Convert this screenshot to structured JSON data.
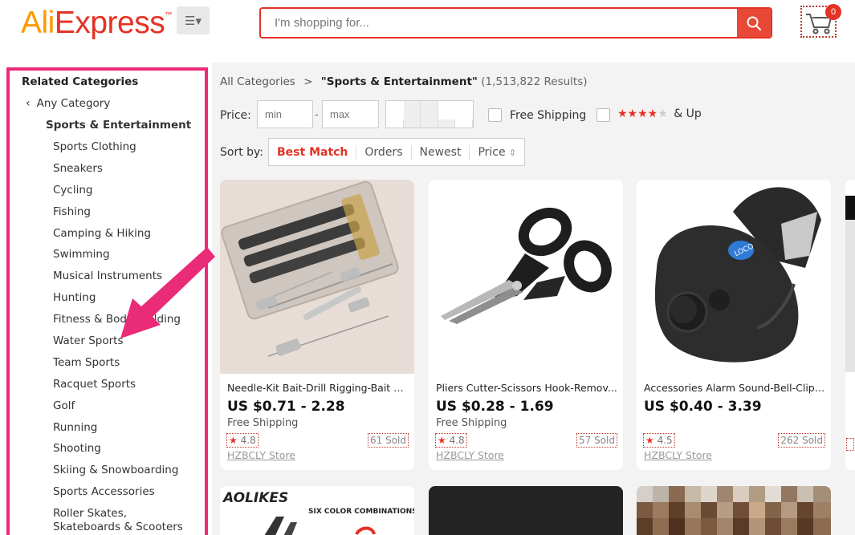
{
  "header": {
    "logo_part1": "Ali",
    "logo_part2": "Express",
    "logo_tm": "™",
    "search_placeholder": "I'm shopping for...",
    "cart_count": "0",
    "icons": [
      "menu-icon",
      "search-icon",
      "cart-icon"
    ]
  },
  "sidebar": {
    "title": "Related Categories",
    "any_category": "Any Category",
    "current": "Sports & Entertainment",
    "items": [
      "Sports Clothing",
      "Sneakers",
      "Cycling",
      "Fishing",
      "Camping & Hiking",
      "Swimming",
      "Musical Instruments",
      "Hunting",
      "Fitness & Body Building",
      "Water Sports",
      "Team Sports",
      "Racquet Sports",
      "Golf",
      "Running",
      "Shooting",
      "Skiing & Snowboarding",
      "Sports Accessories",
      "Roller Skates, Skateboards & Scooters"
    ]
  },
  "breadcrumb": {
    "root": "All Categories",
    "separator": ">",
    "current": "\"Sports & Entertainment\"",
    "count": "(1,513,822 Results)"
  },
  "filters": {
    "price_label": "Price:",
    "min_placeholder": "min",
    "max_placeholder": "max",
    "dash": "-",
    "free_shipping": "Free Shipping",
    "rating_stars_on": "★★★★",
    "rating_stars_off": "★",
    "rating_suffix": "& Up"
  },
  "sort": {
    "label": "Sort by:",
    "options": [
      "Best Match",
      "Orders",
      "Newest",
      "Price"
    ],
    "active": "Best Match",
    "price_icon": "⇕"
  },
  "products": [
    {
      "title": "Needle-Kit Bait-Drill Rigging-Bait St...",
      "price": "US $0.71 - 2.28",
      "shipping": "Free Shipping",
      "rating": "4.8",
      "sold": "61 Sold",
      "store": "HZBCLY Store"
    },
    {
      "title": "Pliers Cutter-Scissors Hook-Remov...",
      "price": "US $0.28 - 1.69",
      "shipping": "Free Shipping",
      "rating": "4.8",
      "sold": "57 Sold",
      "store": "HZBCLY Store"
    },
    {
      "title": "Accessories Alarm Sound-Bell-Clip ...",
      "price": "US $0.40 - 3.39",
      "shipping": "",
      "rating": "4.5",
      "sold": "262 Sold",
      "store": "HZBCLY Store"
    }
  ],
  "second_row": {
    "brand_text": "AOLIKES",
    "promo_text": "SIX COLOR COMBINATIONS"
  },
  "colors": {
    "brand_red": "#e43225",
    "brand_orange": "#ff9900",
    "highlight_pink": "#ea2b78",
    "background": "#f3f3f3"
  }
}
